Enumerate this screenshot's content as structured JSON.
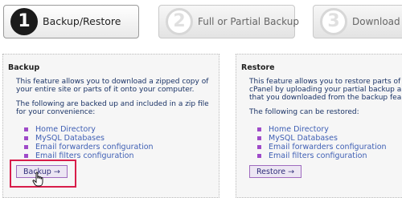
{
  "steps": [
    {
      "number": "1",
      "label": "Backup/Restore",
      "state": "active"
    },
    {
      "number": "2",
      "label": "Full or Partial Backup",
      "state": "inactive"
    },
    {
      "number": "3",
      "label": "Download",
      "state": "inactive"
    }
  ],
  "backup": {
    "title": "Backup",
    "description_line1": "This feature allows you to download a zipped copy of",
    "description_line2": "your entire site or parts of it onto your computer.",
    "list_intro_line1": "The following are backed up and included in a zip file",
    "list_intro_line2": "for your convenience:",
    "items": [
      "Home Directory",
      "MySQL Databases",
      "Email forwarders configuration",
      "Email filters configuration"
    ],
    "button_label": "Backup →"
  },
  "restore": {
    "title": "Restore",
    "description_line1": "This feature allows you to restore parts of",
    "description_line2": "cPanel by uploading your partial backup a",
    "description_line3": "that you downloaded from the backup fea",
    "list_intro": "The following can be restored:",
    "items": [
      "Home Directory",
      "MySQL Databases",
      "Email forwarders configuration",
      "Email filters configuration"
    ],
    "button_label": "Restore →"
  },
  "colors": {
    "link": "#3f5fb4",
    "bullet": "#9f4bc9",
    "highlight": "#d81d4a",
    "panel_bg": "#f6f6f6"
  }
}
